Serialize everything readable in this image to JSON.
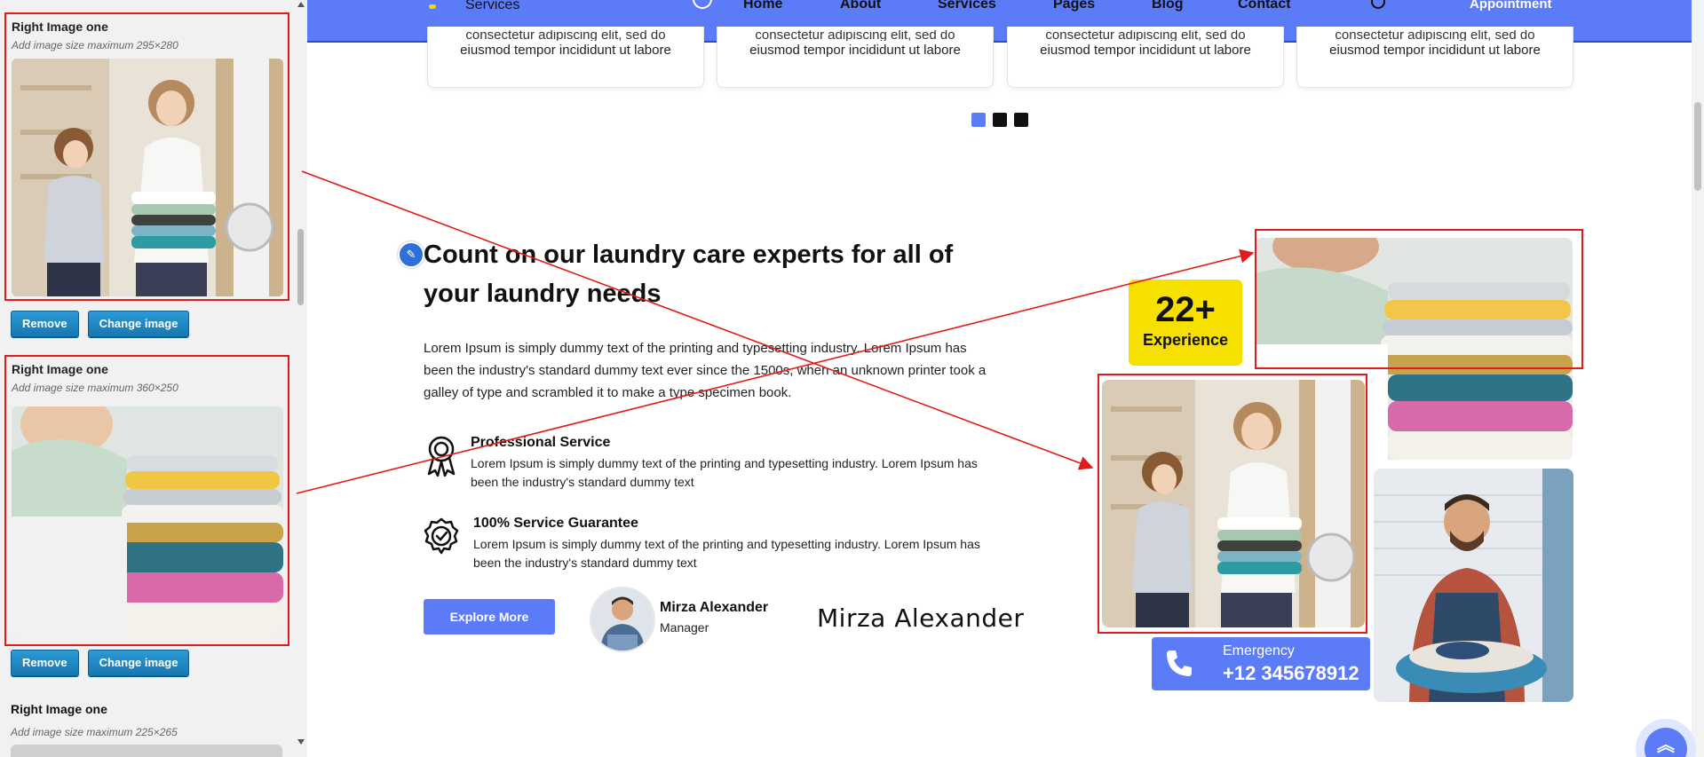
{
  "customizer": {
    "fields": [
      {
        "title": "Right Image one",
        "hint": "Add image size maximum 295×280",
        "remove_label": "Remove",
        "change_label": "Change image"
      },
      {
        "title": "Right Image one",
        "hint": "Add image size maximum 360×250",
        "remove_label": "Remove",
        "change_label": "Change image"
      },
      {
        "title": "Right Image one",
        "hint": "Add image size maximum 225×265"
      }
    ]
  },
  "nav": {
    "logo_text": "Services",
    "menu": [
      "Home",
      "About",
      "Services",
      "Pages",
      "Blog",
      "Contact"
    ],
    "appointment_label": "Appointment"
  },
  "service_cards": [
    {
      "line_ghost": "consectetur adipiscing elit, sed do",
      "line": "eiusmod tempor incididunt ut labore"
    },
    {
      "line_ghost": "consectetur adipiscing elit, sed do",
      "line": "eiusmod tempor incididunt ut labore"
    },
    {
      "line_ghost": "consectetur adipiscing elit, sed do",
      "line": "eiusmod tempor incididunt ut labore"
    },
    {
      "line_ghost": "consectetur adipiscing elit, sed do",
      "line": "eiusmod tempor incididunt ut labore"
    }
  ],
  "about": {
    "heading": "Count on our laundry care experts for all of your laundry needs",
    "paragraph": "Lorem Ipsum is simply dummy text of the printing and typesetting industry. Lorem Ipsum has been the industry's standard dummy text ever since the 1500s, when an unknown printer took a galley of type and scrambled it to make a type specimen book.",
    "features": [
      {
        "title": "Professional Service",
        "text": "Lorem Ipsum is simply dummy text of the printing and typesetting industry. Lorem Ipsum has been the industry's standard dummy text",
        "icon": "award-ribbon-icon"
      },
      {
        "title": "100% Service Guarantee",
        "text": "Lorem Ipsum is simply dummy text of the printing and typesetting industry. Lorem Ipsum has been the industry's standard dummy text",
        "icon": "badge-check-icon"
      }
    ],
    "cta_label": "Explore More",
    "manager_name": "Mirza Alexander",
    "manager_role": "Manager",
    "signature": "Mirza Alexander"
  },
  "experience": {
    "number": "22+",
    "label": "Experience"
  },
  "emergency": {
    "label": "Emergency",
    "phone": "+12 345678912"
  },
  "colors": {
    "primary": "#5b7cf6",
    "badge": "#f6e000",
    "selection": "#e01b1b",
    "wp_button": "#1e88c7"
  }
}
